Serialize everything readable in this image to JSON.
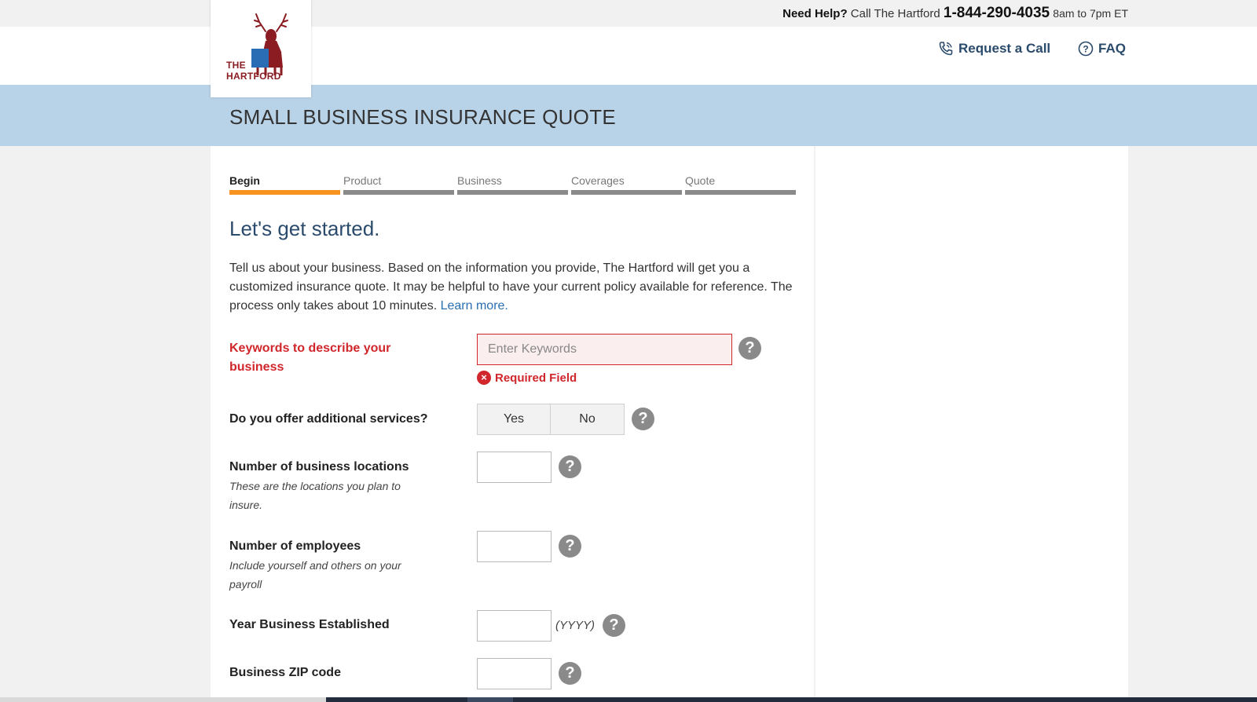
{
  "topbar": {
    "need_help": "Need Help?",
    "call_text": "Call The Hartford",
    "phone": "1-844-290-4035",
    "hours": "8am to 7pm ET"
  },
  "header": {
    "request_call": "Request a Call",
    "faq": "FAQ",
    "link_color": "#2b4b6c"
  },
  "logo": {
    "line1": "THE",
    "line2": "HARTFORD",
    "color": "#8a1c22"
  },
  "banner": {
    "title": "SMALL BUSINESS INSURANCE QUOTE",
    "color": "#b8d2e8"
  },
  "steps": [
    {
      "label": "Begin",
      "active": true
    },
    {
      "label": "Product",
      "active": false
    },
    {
      "label": "Business",
      "active": false
    },
    {
      "label": "Coverages",
      "active": false
    },
    {
      "label": "Quote",
      "active": false
    }
  ],
  "steps_colors": {
    "active": "#f7931e",
    "inactive": "#8a8a8a"
  },
  "intro": {
    "title": "Let's get started.",
    "text": "Tell us about your business. Based on the information you provide, The Hartford will get you a customized insurance quote. It may be helpful to have your current policy available for reference. The process only takes about 10 minutes.",
    "learn_more": "Learn more."
  },
  "form": {
    "keywords": {
      "label": "Keywords to describe your business",
      "placeholder": "Enter Keywords",
      "value": "",
      "error": "Required Field",
      "error_color": "#d0262c"
    },
    "additional_services": {
      "label": "Do you offer additional services?",
      "yes": "Yes",
      "no": "No"
    },
    "locations": {
      "label": "Number of business locations",
      "sub": "These are the locations you plan to insure.",
      "value": ""
    },
    "employees": {
      "label": "Number of employees",
      "sub": "Include yourself and others on your payroll",
      "value": ""
    },
    "year": {
      "label": "Year Business Established",
      "format_hint": "(YYYY)",
      "value": ""
    },
    "zip": {
      "label": "Business ZIP code",
      "value": ""
    },
    "help_icon": "?"
  }
}
